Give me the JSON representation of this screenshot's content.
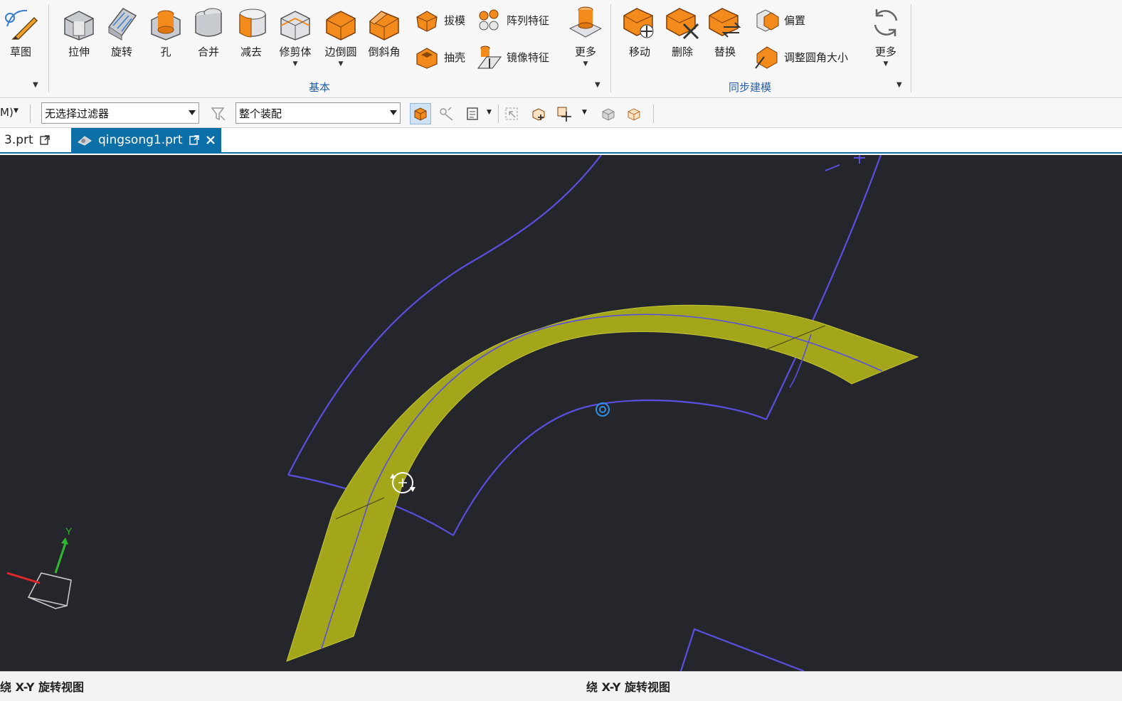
{
  "ribbon": {
    "sketch": {
      "label": "草图"
    },
    "basic_tools": [
      {
        "label": "拉伸"
      },
      {
        "label": "旋转"
      },
      {
        "label": "孔"
      },
      {
        "label": "合并"
      },
      {
        "label": "减去"
      },
      {
        "label": "修剪体"
      },
      {
        "label": "边倒圆"
      },
      {
        "label": "倒斜角"
      }
    ],
    "small_tools": {
      "draft": "拔模",
      "shell": "抽壳",
      "pattern": "阵列特征",
      "mirror": "镜像特征"
    },
    "more_basic": "更多",
    "basic_group": "基本",
    "sync_tools": [
      {
        "label": "移动"
      },
      {
        "label": "删除"
      },
      {
        "label": "替换"
      }
    ],
    "sync_small": {
      "offset": "偏置",
      "resize_blend": "调整圆角大小"
    },
    "more_sync": "更多",
    "sync_group": "同步建模"
  },
  "filterbar": {
    "menu_stub": "M)",
    "selection_filter": "无选择过滤器",
    "scope": "整个装配"
  },
  "tabs": [
    {
      "label": "3.prt",
      "active": false
    },
    {
      "label": "qingsong1.prt",
      "active": true
    }
  ],
  "viewport": {
    "background": "#25262b",
    "curve_color": "#5a4fe0",
    "surface_color": "#a3a51a",
    "axis_label_y": "Y"
  },
  "status": {
    "left": "绕 X-Y 旋转视图",
    "center": "绕 X-Y 旋转视图"
  }
}
